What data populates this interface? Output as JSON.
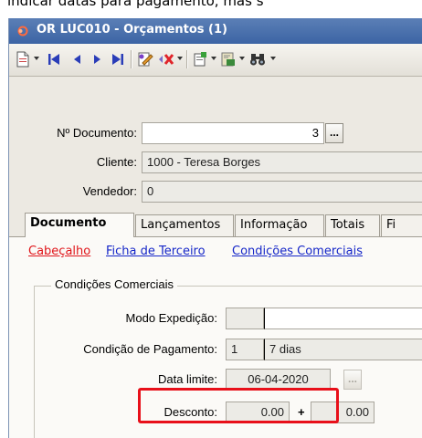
{
  "header_text": "indicar datas para pagamento, mas s",
  "window": {
    "title": "OR LUC010 - Orçamentos (1)"
  },
  "icons": {
    "app": "app-record-icon",
    "toolbar": [
      "new-document-icon",
      "first-record-icon",
      "previous-record-icon",
      "next-record-icon",
      "last-record-icon",
      "edit-record-icon",
      "delete-record-icon",
      "notes-icon",
      "export-icon",
      "search-binoculars-icon"
    ]
  },
  "colors": {
    "titlebar": "#3c64a4",
    "link": "#1526c8",
    "link_active": "#e0151a",
    "highlight": "#e8101a"
  },
  "form": {
    "documento": {
      "label": "Nº Documento:",
      "value": "3",
      "button": "..."
    },
    "cliente": {
      "label": "Cliente:",
      "value": "1000 - Teresa Borges"
    },
    "vendedor": {
      "label": "Vendedor:",
      "value": "0"
    }
  },
  "tabs": [
    {
      "label": "Documento"
    },
    {
      "label": "Lançamentos"
    },
    {
      "label": "Informação"
    },
    {
      "label": "Totais"
    },
    {
      "label": "Fi"
    }
  ],
  "subtabs": [
    {
      "label": "Cabeçalho"
    },
    {
      "label": "Ficha de Terceiro"
    },
    {
      "label": "Condições Comerciais"
    }
  ],
  "conditions": {
    "group_title": "Condições Comerciais",
    "modo_expedicao": {
      "label": "Modo Expedição:",
      "code": "",
      "desc": ""
    },
    "condicao_pagamento": {
      "label": "Condição de Pagamento:",
      "code": "1",
      "desc": "7 dias"
    },
    "data_limite": {
      "label": "Data limite:",
      "value": "06-04-2020",
      "button": "..."
    },
    "desconto": {
      "label": "Desconto:",
      "value1": "0.00",
      "operator": "+",
      "value2": "0.00"
    }
  }
}
